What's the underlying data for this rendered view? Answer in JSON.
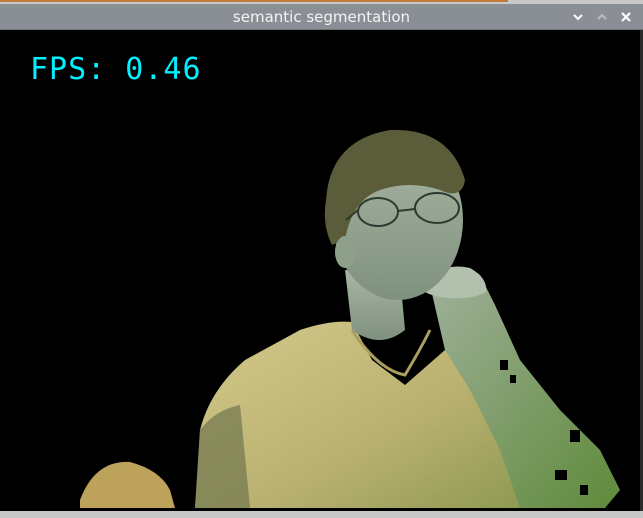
{
  "window": {
    "title": "semantic segmentation",
    "controls": {
      "minimize_icon": "chevron-down-icon",
      "maximize_icon": "chevron-up-icon",
      "close_icon": "close-icon"
    }
  },
  "overlay": {
    "fps_text": "FPS: 0.46",
    "fps_color": "#00f0ff"
  },
  "colors": {
    "titlebar": "#8a8f96",
    "background": "#000000",
    "shirt": "#c9c07a",
    "skin": "#8fa090"
  }
}
